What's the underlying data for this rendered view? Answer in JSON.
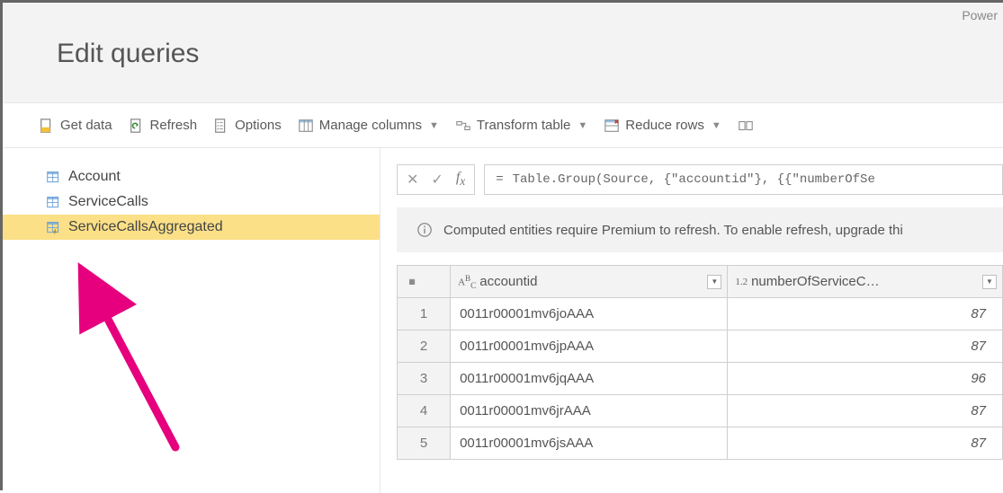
{
  "brand": "Power",
  "page_title": "Edit queries",
  "toolbar": {
    "get_data": "Get data",
    "refresh": "Refresh",
    "options": "Options",
    "manage_columns": "Manage columns",
    "transform_table": "Transform table",
    "reduce_rows": "Reduce rows"
  },
  "queries": [
    {
      "name": "Account",
      "selected": false,
      "computed": false
    },
    {
      "name": "ServiceCalls",
      "selected": false,
      "computed": false
    },
    {
      "name": "ServiceCallsAggregated",
      "selected": true,
      "computed": true
    }
  ],
  "formula": {
    "eq": "=",
    "text": "Table.Group(Source, {\"accountid\"}, {{\"numberOfSe"
  },
  "notice": "Computed entities require Premium to refresh. To enable refresh, upgrade thi",
  "columns": [
    {
      "header": "accountid",
      "type": "ABC"
    },
    {
      "header": "numberOfServiceC…",
      "type": "1.2"
    }
  ],
  "rows": [
    {
      "n": 1,
      "accountid": "0011r00001mv6joAAA",
      "val": 87
    },
    {
      "n": 2,
      "accountid": "0011r00001mv6jpAAA",
      "val": 87
    },
    {
      "n": 3,
      "accountid": "0011r00001mv6jqAAA",
      "val": 96
    },
    {
      "n": 4,
      "accountid": "0011r00001mv6jrAAA",
      "val": 87
    },
    {
      "n": 5,
      "accountid": "0011r00001mv6jsAAA",
      "val": 87
    }
  ]
}
